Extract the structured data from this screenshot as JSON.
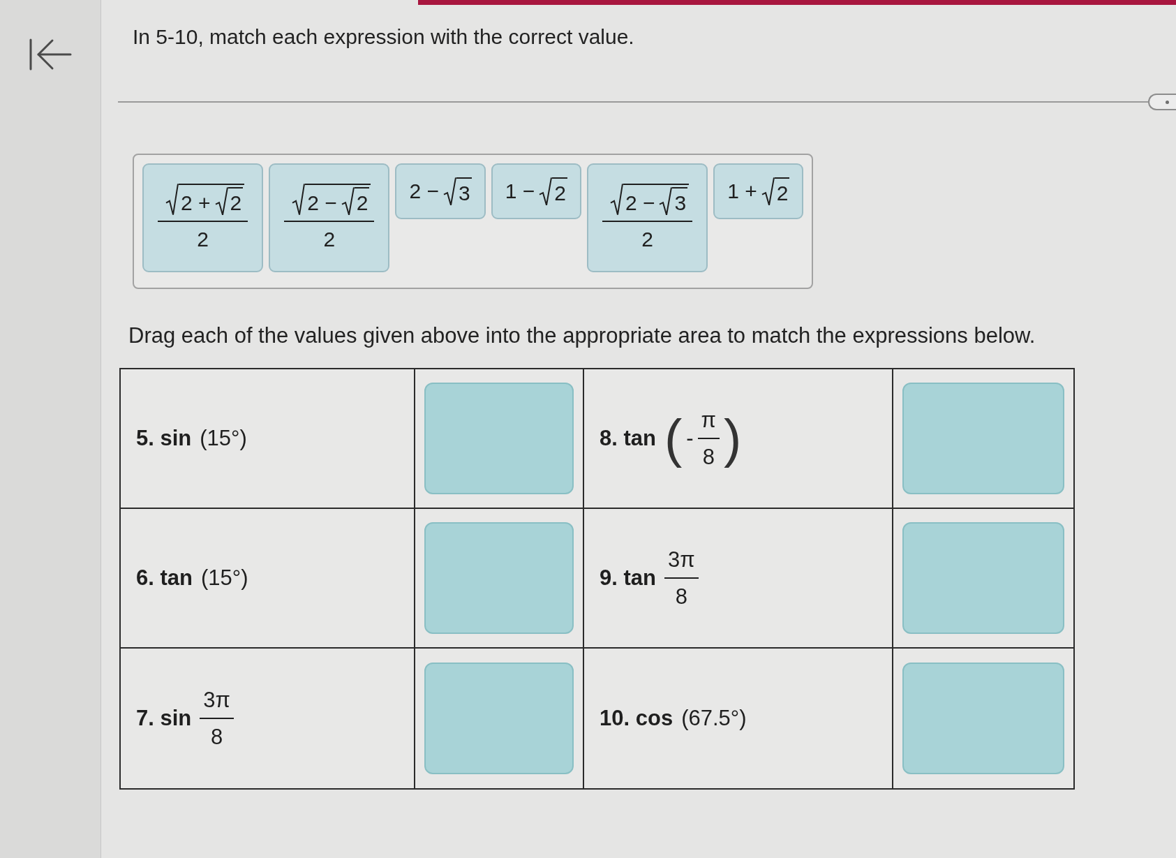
{
  "instruction": "In 5-10, match each expression with the correct value.",
  "values": [
    {
      "expression": [
        {
          "kind": "fraction",
          "numerator": [
            {
              "kind": "sqrt",
              "children": [
                {
                  "kind": "text",
                  "text": "2 +"
                },
                {
                  "kind": "sqrt",
                  "children": [
                    {
                      "kind": "text",
                      "text": "2"
                    }
                  ]
                }
              ]
            }
          ],
          "denominator": [
            {
              "kind": "text",
              "text": "2"
            }
          ]
        }
      ]
    },
    {
      "expression": [
        {
          "kind": "fraction",
          "numerator": [
            {
              "kind": "sqrt",
              "children": [
                {
                  "kind": "text",
                  "text": "2 −"
                },
                {
                  "kind": "sqrt",
                  "children": [
                    {
                      "kind": "text",
                      "text": "2"
                    }
                  ]
                }
              ]
            }
          ],
          "denominator": [
            {
              "kind": "text",
              "text": "2"
            }
          ]
        }
      ]
    },
    {
      "expression": [
        {
          "kind": "text",
          "text": "2 −"
        },
        {
          "kind": "sqrt",
          "children": [
            {
              "kind": "text",
              "text": "3"
            }
          ]
        }
      ]
    },
    {
      "expression": [
        {
          "kind": "text",
          "text": "1 −"
        },
        {
          "kind": "sqrt",
          "children": [
            {
              "kind": "text",
              "text": "2"
            }
          ]
        }
      ]
    },
    {
      "expression": [
        {
          "kind": "fraction",
          "numerator": [
            {
              "kind": "sqrt",
              "children": [
                {
                  "kind": "text",
                  "text": "2 −"
                },
                {
                  "kind": "sqrt",
                  "children": [
                    {
                      "kind": "text",
                      "text": "3"
                    }
                  ]
                }
              ]
            }
          ],
          "denominator": [
            {
              "kind": "text",
              "text": "2"
            }
          ]
        }
      ]
    },
    {
      "expression": [
        {
          "kind": "text",
          "text": "1 +"
        },
        {
          "kind": "sqrt",
          "children": [
            {
              "kind": "text",
              "text": "2"
            }
          ]
        }
      ]
    }
  ],
  "drag_instruction": "Drag each of the values given above into the appropriate area to match the expressions below.",
  "table": {
    "rows": [
      {
        "items": [
          {
            "expression": [
              {
                "kind": "label",
                "text": "5. sin"
              },
              {
                "kind": "text",
                "text": "(15°)"
              }
            ]
          },
          {
            "expression": [
              {
                "kind": "label",
                "text": "8. tan"
              },
              {
                "kind": "parens",
                "open": "(",
                "close": ")",
                "children": [
                  {
                    "kind": "text",
                    "text": "-"
                  },
                  {
                    "kind": "fraction",
                    "numerator": [
                      {
                        "kind": "text",
                        "text": "π"
                      }
                    ],
                    "denominator": [
                      {
                        "kind": "text",
                        "text": "8"
                      }
                    ]
                  }
                ]
              }
            ]
          }
        ]
      },
      {
        "items": [
          {
            "expression": [
              {
                "kind": "label",
                "text": "6. tan"
              },
              {
                "kind": "text",
                "text": "(15°)"
              }
            ]
          },
          {
            "expression": [
              {
                "kind": "label",
                "text": "9. tan"
              },
              {
                "kind": "fraction",
                "numerator": [
                  {
                    "kind": "text",
                    "text": "3π"
                  }
                ],
                "denominator": [
                  {
                    "kind": "text",
                    "text": "8"
                  }
                ]
              }
            ]
          }
        ]
      },
      {
        "items": [
          {
            "expression": [
              {
                "kind": "label",
                "text": "7. sin"
              },
              {
                "kind": "fraction",
                "numerator": [
                  {
                    "kind": "text",
                    "text": "3π"
                  }
                ],
                "denominator": [
                  {
                    "kind": "text",
                    "text": "8"
                  }
                ]
              }
            ]
          },
          {
            "expression": [
              {
                "kind": "label",
                "text": "10. cos"
              },
              {
                "kind": "text",
                "text": "(67.5°)"
              }
            ]
          }
        ]
      }
    ]
  }
}
